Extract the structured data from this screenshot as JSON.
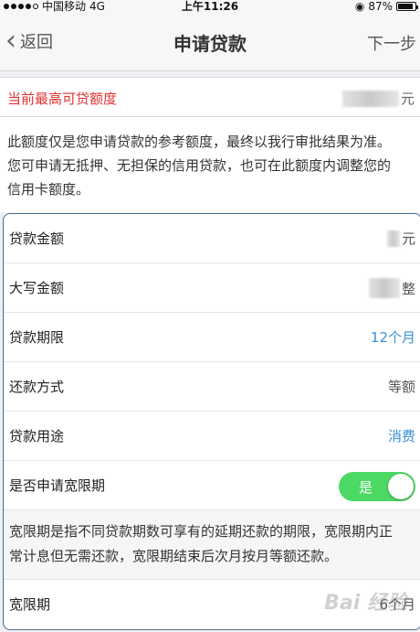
{
  "status_bar": {
    "carrier": "中国移动",
    "network": "4G",
    "time": "上午11:26",
    "battery": "87%",
    "battery_level": 0.87
  },
  "nav": {
    "back_label": "返回",
    "title": "申请贷款",
    "next_label": "下一步"
  },
  "limit": {
    "label": "当前最高可贷额度",
    "unit": "元"
  },
  "notice": {
    "line1": "此额度仅是您申请贷款的参考额度，最终以我行审批结果为准。",
    "line2": "您可申请无抵押、无担保的信用贷款，也可在此额度内调整您的",
    "line3": "信用卡额度。"
  },
  "form": {
    "amount": {
      "label": "贷款金额",
      "unit": "元"
    },
    "amount_upper": {
      "label": "大写金额",
      "unit": "整"
    },
    "term": {
      "label": "贷款期限",
      "value": "12个月"
    },
    "repay": {
      "label": "还款方式",
      "value": "等额"
    },
    "purpose": {
      "label": "贷款用途",
      "value": "消费"
    },
    "grace_toggle": {
      "label": "是否申请宽限期",
      "value": "是",
      "on": true
    },
    "grace_desc": {
      "line1": "宽限期是指不同贷款期数可享有的延期还款的期限，宽限期内正",
      "line2": "常计息但无需还款，宽限期结束后次月按月等额还款。"
    },
    "grace_period": {
      "label": "宽限期",
      "value": "6个月"
    }
  },
  "watermark": "Bai 经验"
}
